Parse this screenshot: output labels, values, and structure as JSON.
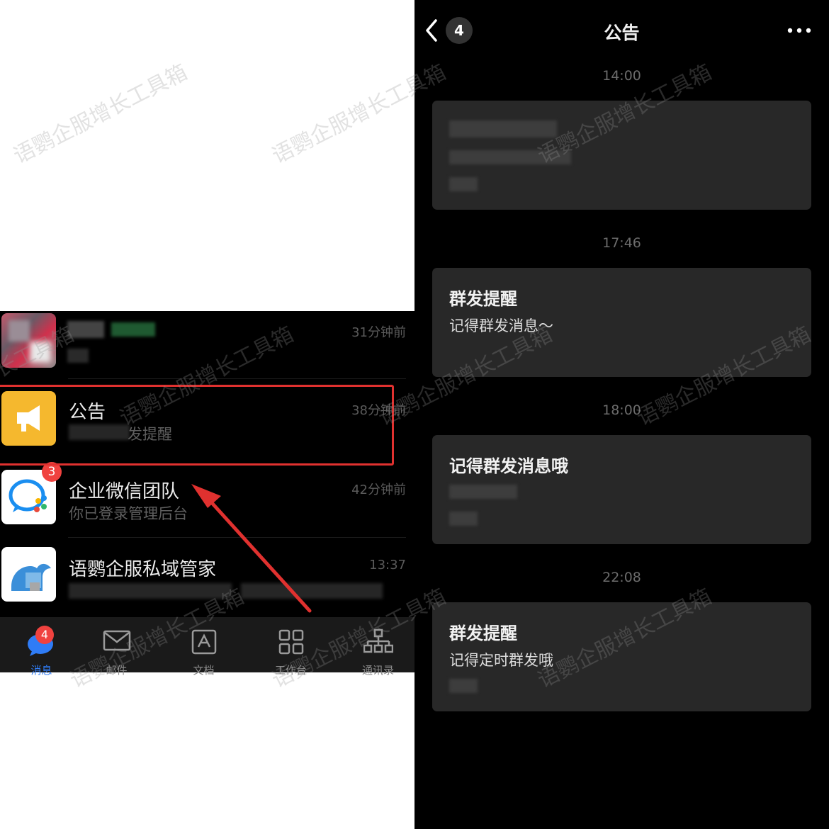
{
  "left": {
    "chats": [
      {
        "name": "",
        "preview": "",
        "time": "31分钟前"
      },
      {
        "name": "公告",
        "preview": "发提醒",
        "time": "38分钟前"
      },
      {
        "name": "企业微信团队",
        "preview": "你已登录管理后台",
        "time": "42分钟前",
        "badge": "3"
      },
      {
        "name": "语鹦企服私域管家",
        "preview": "",
        "time": "13:37"
      }
    ],
    "tabs": [
      {
        "label": "消息",
        "icon": "chat-bubble-icon",
        "badge": "4",
        "active": true
      },
      {
        "label": "邮件",
        "icon": "mail-icon"
      },
      {
        "label": "文档",
        "icon": "document-icon"
      },
      {
        "label": "工作台",
        "icon": "grid-icon"
      },
      {
        "label": "通讯录",
        "icon": "org-chart-icon"
      }
    ],
    "colors": {
      "highlight": "#e0312f",
      "arrow": "#e0312f",
      "badge": "#f0423f",
      "announce_icon_bg": "#f5b82e",
      "active_tab": "#2f7cf6"
    }
  },
  "right": {
    "back_count": "4",
    "title": "公告",
    "messages": [
      {
        "time": "14:00",
        "title": "",
        "body": ""
      },
      {
        "time": "17:46",
        "title": "群发提醒",
        "body": "记得群发消息～"
      },
      {
        "time": "18:00",
        "title": "记得群发消息哦",
        "body": ""
      },
      {
        "time": "22:08",
        "title": "群发提醒",
        "body": "记得定时群发哦"
      }
    ]
  },
  "watermark": "语鹦企服增长工具箱"
}
